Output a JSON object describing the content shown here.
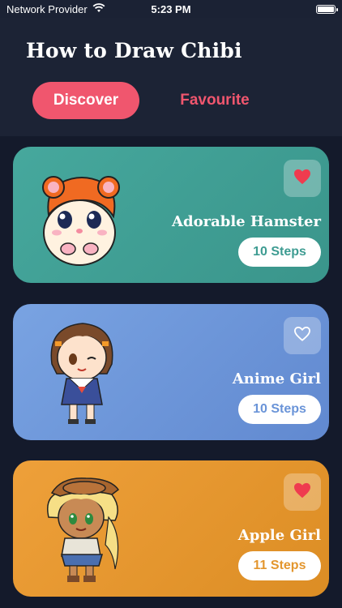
{
  "status_bar": {
    "carrier": "Network Provider",
    "time": "5:23 PM",
    "wifi_icon": "wifi-icon",
    "battery_icon": "battery-icon"
  },
  "header": {
    "title": "How to Draw Chibi",
    "tabs": [
      {
        "label": "Discover",
        "active": true
      },
      {
        "label": "Favourite",
        "active": false
      }
    ]
  },
  "colors": {
    "accent": "#f0566e",
    "background": "#141a2b",
    "header": "#1c2335"
  },
  "cards": [
    {
      "title": "Adorable Hamster",
      "steps": "10 Steps",
      "favourite": true,
      "color": "#3e9c92",
      "icon": "hamster-illustration"
    },
    {
      "title": "Anime Girl",
      "steps": "10 Steps",
      "favourite": false,
      "color": "#6a94d8",
      "icon": "anime-girl-illustration"
    },
    {
      "title": "Apple Girl",
      "steps": "11 Steps",
      "favourite": true,
      "color": "#e3962e",
      "icon": "apple-girl-illustration"
    }
  ]
}
